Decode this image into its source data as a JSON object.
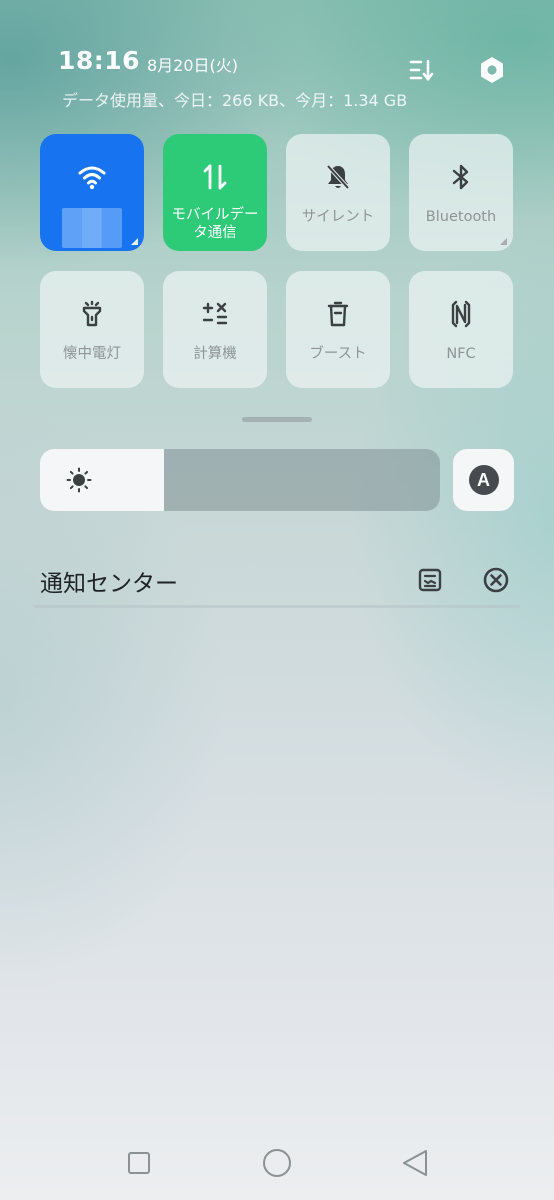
{
  "header": {
    "time": "18:16",
    "date": "8月20日(火)",
    "data_usage": "データ使用量、今日：266 KB、今月：1.34 GB",
    "edit_icon": "edit-tiles-icon",
    "settings_icon": "settings-hexagon-icon"
  },
  "tiles": [
    {
      "label": "",
      "icon": "wifi-icon",
      "state": "on",
      "color": "#1773f0"
    },
    {
      "label": "モバイルデータ通信",
      "icon": "mobile-data-icon",
      "state": "on",
      "color": "#2dcb78"
    },
    {
      "label": "サイレント",
      "icon": "bell-off-icon",
      "state": "off"
    },
    {
      "label": "Bluetooth",
      "icon": "bluetooth-icon",
      "state": "off"
    },
    {
      "label": "懐中電灯",
      "icon": "flashlight-icon",
      "state": "off"
    },
    {
      "label": "計算機",
      "icon": "calculator-icon",
      "state": "off"
    },
    {
      "label": "ブースト",
      "icon": "trash-boost-icon",
      "state": "off"
    },
    {
      "label": "NFC",
      "icon": "nfc-icon",
      "state": "off"
    }
  ],
  "brightness": {
    "level": 0.31,
    "icon": "sun-icon",
    "auto_label": "A"
  },
  "notification_center": {
    "title": "通知センター",
    "manage_icon": "notification-manage-icon",
    "clear_icon": "clear-all-icon"
  },
  "navbar": {
    "recent": "recent-apps-icon",
    "home": "home-icon",
    "back": "back-icon"
  }
}
